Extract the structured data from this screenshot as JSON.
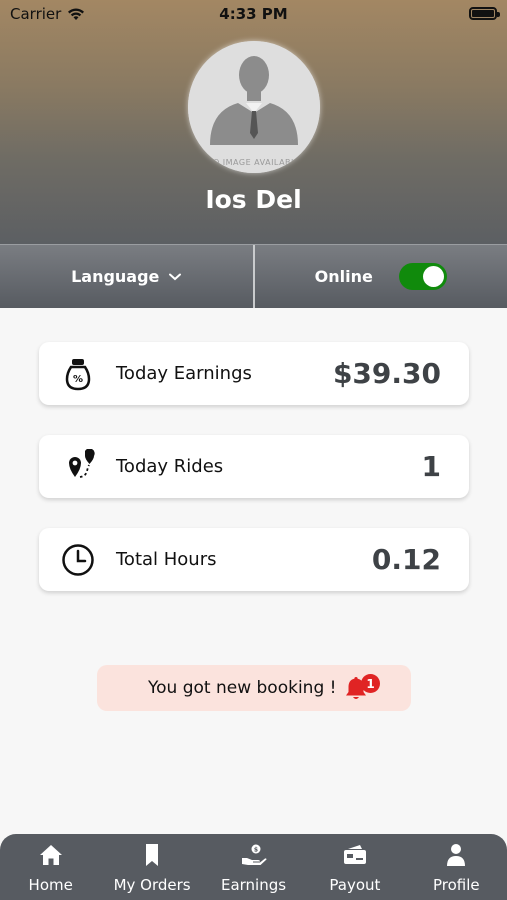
{
  "status_bar": {
    "carrier": "Carrier",
    "time": "4:33 PM"
  },
  "profile": {
    "name": "Ios Del",
    "avatar_caption": "NO IMAGE AVAILABLE"
  },
  "controls": {
    "language_label": "Language",
    "status_label": "Online",
    "online": true
  },
  "stats": [
    {
      "icon": "money-jar-icon",
      "label": "Today Earnings",
      "value": "$39.30"
    },
    {
      "icon": "route-pin-icon",
      "label": "Today Rides",
      "value": "1"
    },
    {
      "icon": "clock-icon",
      "label": "Total Hours",
      "value": "0.12"
    }
  ],
  "notification": {
    "text": "You got new booking !",
    "count": "1"
  },
  "tabs": [
    {
      "icon": "home-icon",
      "label": "Home"
    },
    {
      "icon": "bookmark-icon",
      "label": "My Orders"
    },
    {
      "icon": "earnings-icon",
      "label": "Earnings"
    },
    {
      "icon": "payout-icon",
      "label": "Payout"
    },
    {
      "icon": "profile-icon",
      "label": "Profile"
    }
  ],
  "colors": {
    "toggle_on": "#108a0c",
    "badge": "#e02424",
    "toast_bg": "#fbe3dd",
    "bell": "#e02424"
  }
}
